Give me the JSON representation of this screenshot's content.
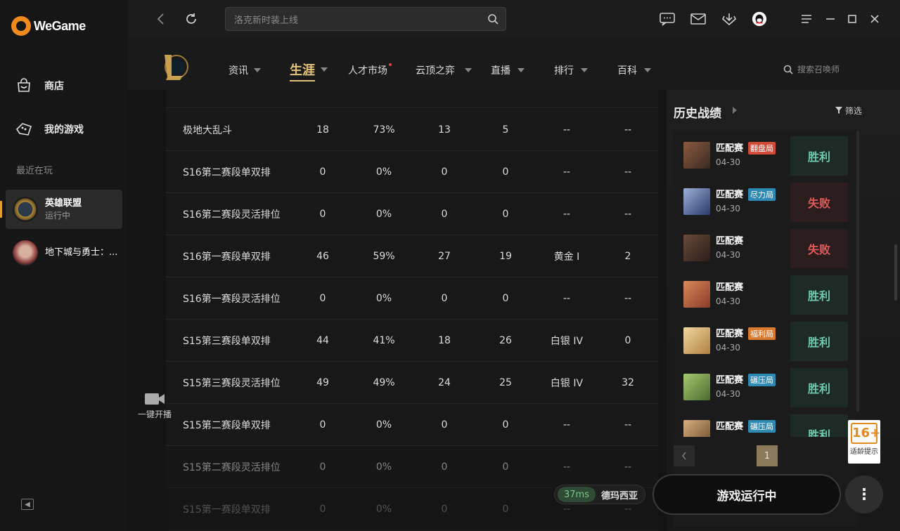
{
  "app": {
    "name": "WeGame"
  },
  "sidebar": {
    "nav": [
      {
        "label": "商店",
        "icon": "store-icon"
      },
      {
        "label": "我的游戏",
        "icon": "gamepad-icon"
      }
    ],
    "recent_label": "最近在玩",
    "games": [
      {
        "name": "英雄联盟",
        "status": "运行中"
      },
      {
        "name": "地下城与勇士：...",
        "status": ""
      }
    ]
  },
  "topbar": {
    "search_placeholder": "洛克新时装上线"
  },
  "game_nav": {
    "items": [
      "资讯",
      "生涯",
      "人才市场",
      "云顶之弈",
      "直播",
      "排行",
      "百科"
    ],
    "summoner_search": "搜索召唤师"
  },
  "table": {
    "rows": [
      {
        "name": "极地大乱斗",
        "c1": "18",
        "c2": "73%",
        "c3": "13",
        "c4": "5",
        "c5": "--",
        "c6": "--"
      },
      {
        "name": "S16第二赛段单双排",
        "c1": "0",
        "c2": "0%",
        "c3": "0",
        "c4": "0",
        "c5": "--",
        "c6": "--"
      },
      {
        "name": "S16第二赛段灵活排位",
        "c1": "0",
        "c2": "0%",
        "c3": "0",
        "c4": "0",
        "c5": "--",
        "c6": "--"
      },
      {
        "name": "S16第一赛段单双排",
        "c1": "46",
        "c2": "59%",
        "c3": "27",
        "c4": "19",
        "c5": "黄金 I",
        "c6": "2"
      },
      {
        "name": "S16第一赛段灵活排位",
        "c1": "0",
        "c2": "0%",
        "c3": "0",
        "c4": "0",
        "c5": "--",
        "c6": "--"
      },
      {
        "name": "S15第三赛段单双排",
        "c1": "44",
        "c2": "41%",
        "c3": "18",
        "c4": "26",
        "c5": "白银 IV",
        "c6": "0"
      },
      {
        "name": "S15第三赛段灵活排位",
        "c1": "49",
        "c2": "49%",
        "c3": "24",
        "c4": "25",
        "c5": "白银 IV",
        "c6": "32"
      },
      {
        "name": "S15第二赛段单双排",
        "c1": "0",
        "c2": "0%",
        "c3": "0",
        "c4": "0",
        "c5": "--",
        "c6": "--"
      },
      {
        "name": "S15第二赛段灵活排位",
        "c1": "0",
        "c2": "0%",
        "c3": "0",
        "c4": "0",
        "c5": "--",
        "c6": "--"
      },
      {
        "name": "S15第一赛段单双排",
        "c1": "0",
        "c2": "0%",
        "c3": "0",
        "c4": "0",
        "c5": "--",
        "c6": "--"
      }
    ]
  },
  "live": {
    "label": "一键开播"
  },
  "history": {
    "title": "历史战绩",
    "filter": "筛选",
    "matches": [
      {
        "mode": "匹配赛",
        "tag": "翻盘局",
        "tag_color": "red",
        "date": "04-30",
        "result": "胜利",
        "win": true
      },
      {
        "mode": "匹配赛",
        "tag": "尽力局",
        "tag_color": "blue",
        "date": "04-30",
        "result": "失败",
        "win": false
      },
      {
        "mode": "匹配赛",
        "tag": "",
        "tag_color": "",
        "date": "04-30",
        "result": "失败",
        "win": false
      },
      {
        "mode": "匹配赛",
        "tag": "",
        "tag_color": "",
        "date": "04-30",
        "result": "胜利",
        "win": true
      },
      {
        "mode": "匹配赛",
        "tag": "福利局",
        "tag_color": "orange",
        "date": "04-30",
        "result": "胜利",
        "win": true
      },
      {
        "mode": "匹配赛",
        "tag": "碾压局",
        "tag_color": "blue",
        "date": "04-30",
        "result": "胜利",
        "win": true
      },
      {
        "mode": "匹配赛",
        "tag": "碾压局",
        "tag_color": "blue",
        "date": "",
        "result": "胜利",
        "win": true
      }
    ],
    "page": "1"
  },
  "age_rating": {
    "number": "16+",
    "label": "适龄提示"
  },
  "bottom": {
    "ping": "37ms",
    "server": "德玛西亚",
    "play_label": "游戏运行中"
  }
}
